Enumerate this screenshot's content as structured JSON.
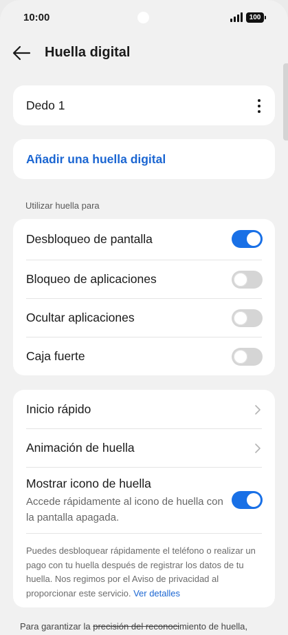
{
  "status_bar": {
    "time": "10:00",
    "battery": "100"
  },
  "header": {
    "title": "Huella digital"
  },
  "finger_card": {
    "label": "Dedo 1"
  },
  "add_card": {
    "label": "Añadir una huella digital"
  },
  "section": {
    "label": "Utilizar huella para"
  },
  "toggles": [
    {
      "label": "Desbloqueo de pantalla",
      "on": true
    },
    {
      "label": "Bloqueo de aplicaciones",
      "on": false
    },
    {
      "label": "Ocultar aplicaciones",
      "on": false
    },
    {
      "label": "Caja fuerte",
      "on": false
    }
  ],
  "settings": {
    "quick_start": "Inicio rápido",
    "animation": "Animación de huella",
    "show_icon": {
      "title": "Mostrar icono de huella",
      "desc": "Accede rápidamente al icono de huella con la pantalla apagada.",
      "on": true
    },
    "info_text": "Puedes desbloquear rápidamente el teléfono o realizar un pago con tu huella después de registrar los datos de tu huella. Nos regimos por el Aviso de privacidad al proporcionar este servicio. ",
    "info_link": "Ver detalles"
  },
  "footer": {
    "pre": "Para garantizar la ",
    "strike": "precisión del reconoci",
    "post": "miento de huella,"
  },
  "colors": {
    "accent": "#1970e6",
    "link": "#1b66d2",
    "background": "#f1f1f1"
  }
}
